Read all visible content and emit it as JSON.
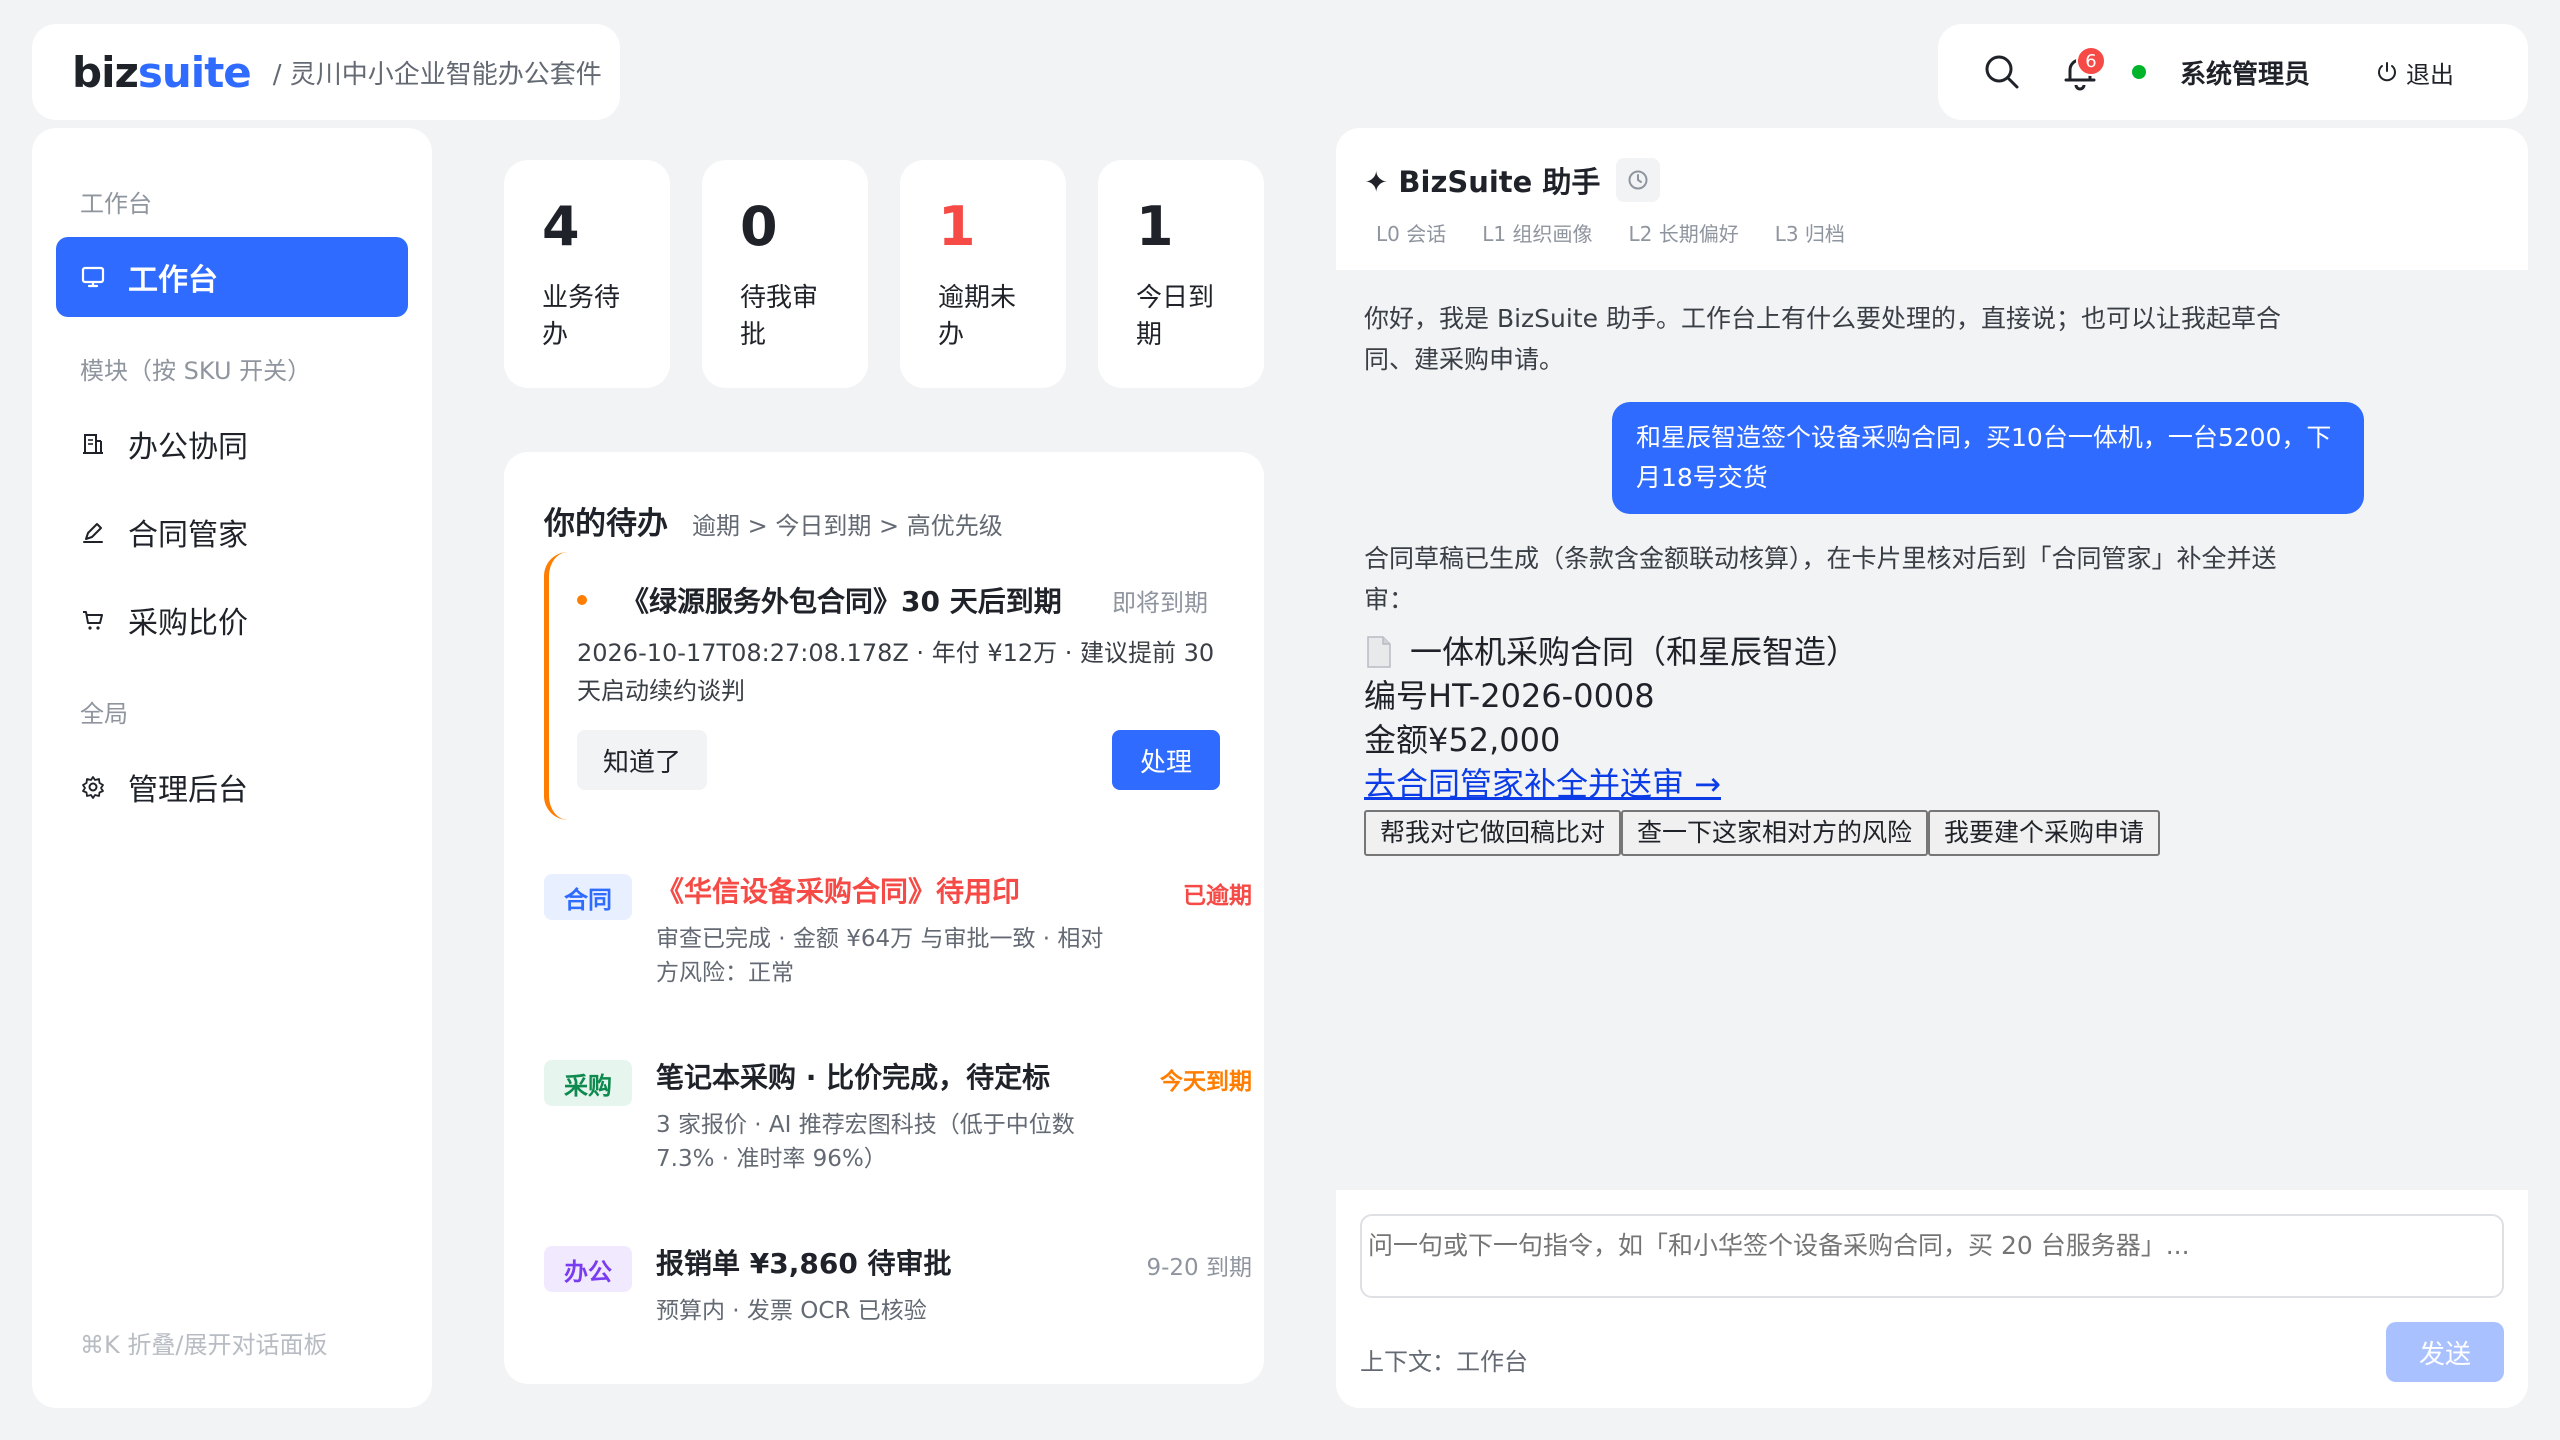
{
  "brand": {
    "logo_main": "biz",
    "logo_accent": "suite",
    "subtitle": "/ 灵川中小企业智能办公套件"
  },
  "topbar": {
    "search_icon": "search-icon",
    "bell_icon": "bell-icon",
    "notification_count": "6",
    "user_name": "系统管理员",
    "logout_label": "退出",
    "online_color": "#00b42a"
  },
  "sidebar": {
    "section_workbench": "工作台",
    "section_modules": "模块（按 SKU 开关）",
    "section_global": "全局",
    "items": [
      {
        "label": "工作台",
        "icon": "monitor-icon",
        "active": true
      },
      {
        "label": "办公协同",
        "icon": "building-icon"
      },
      {
        "label": "合同管家",
        "icon": "pen-icon"
      },
      {
        "label": "采购比价",
        "icon": "cart-icon"
      },
      {
        "label": "管理后台",
        "icon": "gear-icon"
      }
    ],
    "footer": "⌘K 折叠/展开对话面板"
  },
  "stats": [
    {
      "value": "4",
      "label": "业务待办"
    },
    {
      "value": "0",
      "label": "待我审批"
    },
    {
      "value": "1",
      "label": "逾期未办",
      "color": "#f54a45"
    },
    {
      "value": "1",
      "label": "今日到期"
    }
  ],
  "todo": {
    "title": "你的待办",
    "sort_hint": "逾期 > 今日到期 > 高优先级",
    "urgent": {
      "title": "《绿源服务外包合同》30 天后到期",
      "tag": "即将到期",
      "desc": "2026-10-17T08:27:08.178Z · 年付 ¥12万 · 建议提前 30 天启动续约谈判",
      "dismiss_label": "知道了",
      "handle_label": "处理"
    },
    "items": [
      {
        "badge": "合同",
        "title": "《华信设备采购合同》待用印",
        "desc": "审查已完成 · 金额 ¥64万 与审批一致 · 相对方风险：正常",
        "status": "已逾期"
      },
      {
        "badge": "采购",
        "title": "笔记本采购 · 比价完成，待定标",
        "desc": "3 家报价 · AI 推荐宏图科技（低于中位数 7.3% · 准时率 96%）",
        "status": "今天到期"
      },
      {
        "badge": "办公",
        "title": "报销单 ¥3,860 待审批",
        "desc": "预算内 · 发票 OCR 已核验",
        "status": "9-20 到期"
      }
    ]
  },
  "chat": {
    "title": "✦ BizSuite 助手",
    "memory_tabs": [
      "L0 会话",
      "L1 组织画像",
      "L2 长期偏好",
      "L3 归档"
    ],
    "greeting": "你好，我是 BizSuite 助手。工作台上有什么要处理的，直接说；也可以让我起草合同、建采购申请。",
    "user_message": "和星辰智造签个设备采购合同，买10台一体机，一台5200，下月18号交货",
    "reply": "合同草稿已生成（条款含金额联动核算），在卡片里核对后到「合同管家」补全并送审：",
    "draft": {
      "name": "一体机采购合同（和星辰智造）",
      "number": "编号HT-2026-0008",
      "amount": "金额¥52,000",
      "link": "去合同管家补全并送审 →"
    },
    "quick_actions": [
      "帮我对它做回稿比对",
      "查一下这家相对方的风险",
      "我要建个采购申请"
    ],
    "input_placeholder": "问一句或下一句指令，如「和小华签个设备采购合同，买 20 台服务器」...",
    "context": "上下文：工作台",
    "send_label": "发送"
  },
  "colors": {
    "accent": "#2f6bff",
    "danger": "#f54a45",
    "warning": "#ff7d00"
  }
}
